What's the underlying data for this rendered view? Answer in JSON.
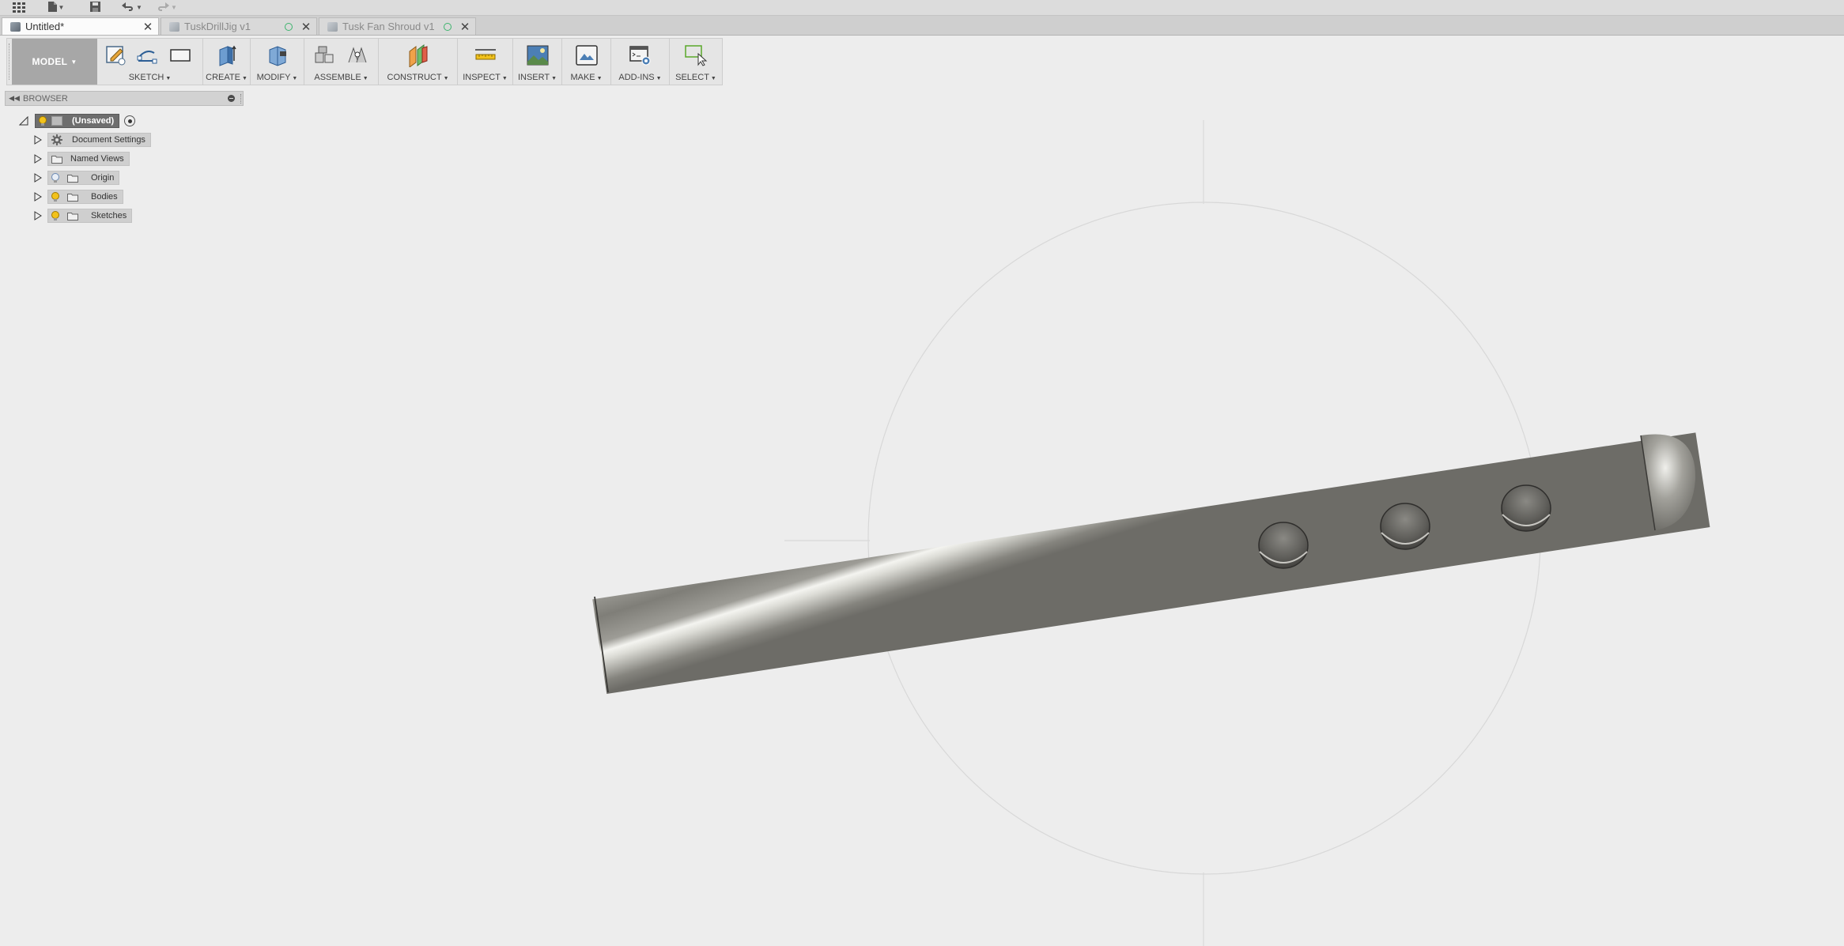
{
  "quick_access": {
    "grid_icon": "data-panel-grid-icon",
    "file_icon": "file-icon",
    "save_icon": "save-icon",
    "undo_icon": "undo-icon",
    "redo_icon": "redo-icon"
  },
  "tabs": [
    {
      "label": "Untitled*",
      "active": true
    },
    {
      "label": "TuskDrillJig v1",
      "active": false
    },
    {
      "label": "Tusk Fan Shroud v1",
      "active": false
    }
  ],
  "toolbar": {
    "workspace": "MODEL",
    "groups": {
      "sketch": "SKETCH",
      "create": "CREATE",
      "modify": "MODIFY",
      "assemble": "ASSEMBLE",
      "construct": "CONSTRUCT",
      "inspect": "INSPECT",
      "insert": "INSERT",
      "make": "MAKE",
      "addins": "ADD-INS",
      "select": "SELECT"
    }
  },
  "browser": {
    "title": "BROWSER",
    "root": "(Unsaved)",
    "nodes": [
      {
        "label": "Document Settings"
      },
      {
        "label": "Named Views"
      },
      {
        "label": "Origin"
      },
      {
        "label": "Bodies"
      },
      {
        "label": "Sketches"
      }
    ]
  },
  "colors": {
    "accent_green": "#3db46d",
    "bulb_yellow": "#f2c21b",
    "model_button": "#a7a7a7"
  }
}
